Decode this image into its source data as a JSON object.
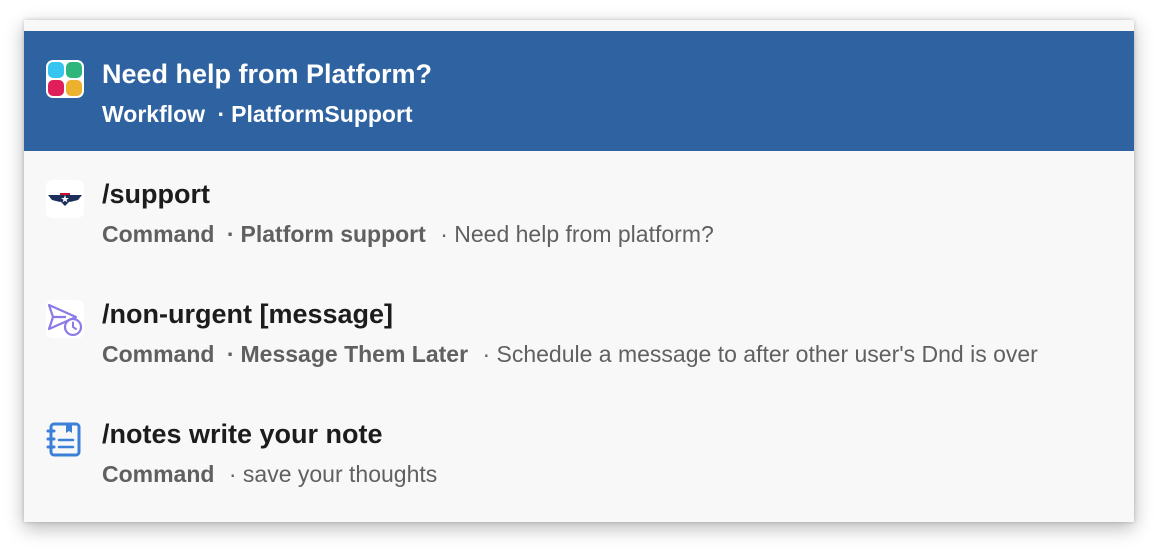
{
  "items": [
    {
      "title": "Need help from Platform?",
      "type": "Workflow",
      "separator": "·",
      "app": "PlatformSupport",
      "description": "",
      "icon": "slack-workflow-icon",
      "selected": true
    },
    {
      "title": "/support",
      "type": "Command",
      "separator": "·",
      "app": "Platform support",
      "description_prefix": "·",
      "description": "Need help from platform?",
      "icon": "platform-support-logo-icon",
      "selected": false
    },
    {
      "title": "/non-urgent [message]",
      "type": "Command",
      "separator": "·",
      "app": "Message Them Later",
      "description_prefix": "·",
      "description": "Schedule a message to after other user's Dnd is over",
      "icon": "send-later-clock-icon",
      "selected": false
    },
    {
      "title": "/notes write your note",
      "type": "Command",
      "separator": "",
      "app": "",
      "description_prefix": "·",
      "description": "save your thoughts",
      "icon": "notebook-icon",
      "selected": false
    }
  ],
  "colors": {
    "selected_bg": "#2e62a0",
    "panel_bg": "#f8f8f8",
    "title_text": "#1d1c1d",
    "sub_text": "#616061"
  }
}
